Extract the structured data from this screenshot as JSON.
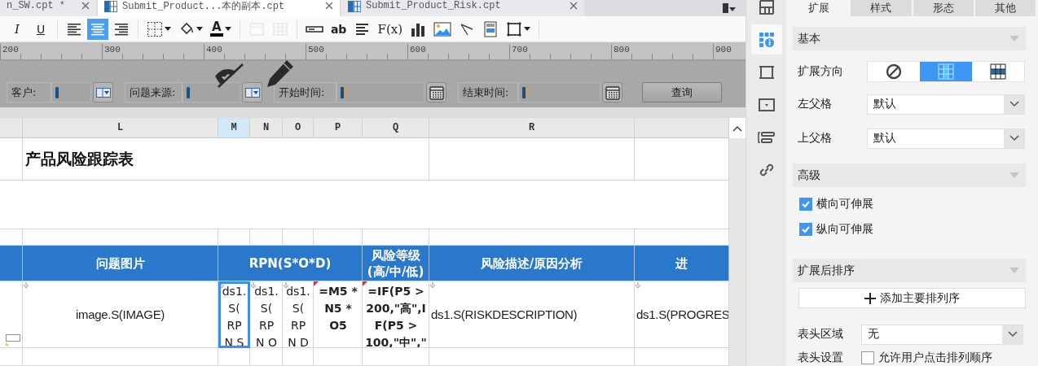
{
  "file_tabs": [
    {
      "label": "n_SW.cpt *",
      "selected": false
    },
    {
      "label": "Submit_Product...本的副本.cpt",
      "selected": true
    },
    {
      "label": "Submit_Product_Risk.cpt",
      "selected": false
    }
  ],
  "toolbar": [
    {
      "kind": "italic",
      "label": "I",
      "selected": false,
      "disabled": false
    },
    {
      "kind": "underline",
      "label": "U",
      "selected": false,
      "disabled": false
    },
    {
      "kind": "sep"
    },
    {
      "kind": "align-left",
      "selected": false,
      "disabled": false
    },
    {
      "kind": "align-center",
      "selected": true,
      "disabled": false
    },
    {
      "kind": "align-right",
      "selected": false,
      "disabled": false
    },
    {
      "kind": "sep"
    },
    {
      "kind": "border",
      "selected": false,
      "disabled": false
    },
    {
      "kind": "fill",
      "selected": false,
      "disabled": false
    },
    {
      "kind": "font-color",
      "label": "A",
      "selected": false,
      "disabled": false
    },
    {
      "kind": "sep"
    },
    {
      "kind": "merge",
      "selected": false,
      "disabled": true
    },
    {
      "kind": "grid",
      "selected": false,
      "disabled": true
    },
    {
      "kind": "sep"
    },
    {
      "kind": "textbox",
      "selected": false,
      "disabled": false
    },
    {
      "kind": "text",
      "label": "ab",
      "selected": false,
      "disabled": false
    },
    {
      "kind": "paragraph",
      "selected": false,
      "disabled": false
    },
    {
      "kind": "formula",
      "label": "F(x)",
      "selected": false,
      "disabled": false
    },
    {
      "kind": "chart",
      "selected": false,
      "disabled": false
    },
    {
      "kind": "image",
      "selected": false,
      "disabled": false
    },
    {
      "kind": "slash",
      "selected": false,
      "disabled": false
    },
    {
      "kind": "subreport",
      "selected": false,
      "disabled": false
    },
    {
      "kind": "frame",
      "selected": false,
      "disabled": false
    },
    {
      "kind": "sep"
    }
  ],
  "ruler": [
    "200",
    "300",
    "400",
    "500",
    "600",
    "700",
    "800",
    "900"
  ],
  "params": [
    {
      "label": "客户:",
      "kind": "dropdown"
    },
    {
      "label": "问题来源:",
      "kind": "dropdown"
    },
    {
      "label": "开始时间:",
      "kind": "date"
    },
    {
      "label": "结束时间:",
      "kind": "date"
    }
  ],
  "query_button": "查询",
  "sheet": {
    "columns": [
      {
        "label": "L",
        "selected": false
      },
      {
        "label": "M",
        "selected": true
      },
      {
        "label": "N",
        "selected": false
      },
      {
        "label": "O",
        "selected": false
      },
      {
        "label": "P",
        "selected": false
      },
      {
        "label": "Q",
        "selected": false
      },
      {
        "label": "R",
        "selected": false
      }
    ],
    "title": "产品风险跟踪表",
    "header_cells": [
      "问题图片",
      "RPN(S*O*D)",
      "风险等级(高/中/低)",
      "风险描述/原因分析",
      "进"
    ],
    "data_cells": [
      {
        "text": "image.S(IMAGE)",
        "kind": "data",
        "selected": false
      },
      {
        "text": "ds1.\nS(\nRP\nN S",
        "kind": "data",
        "selected": true
      },
      {
        "text": "ds1.\nS(\nRP\nN O",
        "kind": "data",
        "selected": false
      },
      {
        "text": "ds1.\nS(\nRP\nN D",
        "kind": "data",
        "selected": false
      },
      {
        "text": "=M5 *\nN5 *\nO5",
        "kind": "formula",
        "selected": false
      },
      {
        "text": "=IF(P5 >\n200,\"高\",I\nF(P5 >\n100,\"中\",\"",
        "kind": "formula",
        "selected": false
      },
      {
        "text": "ds1.S(RISKDESCRIPTION)",
        "kind": "data",
        "selected": false
      },
      {
        "text": "ds1.S(PROGRES",
        "kind": "data",
        "selected": false
      }
    ]
  },
  "side_rail": [
    {
      "kind": "cell-element",
      "selected": false
    },
    {
      "kind": "cell-attr",
      "selected": true
    },
    {
      "kind": "border",
      "selected": false
    },
    {
      "kind": "widget",
      "selected": false
    },
    {
      "kind": "condition",
      "selected": false
    },
    {
      "kind": "link",
      "selected": false
    }
  ],
  "panel": {
    "tabs": [
      {
        "label": "扩展",
        "selected": true
      },
      {
        "label": "样式",
        "selected": false
      },
      {
        "label": "形态",
        "selected": false
      },
      {
        "label": "其他",
        "selected": false
      }
    ],
    "basic": {
      "title": "基本",
      "direction": {
        "label": "扩展方向",
        "options": [
          {
            "kind": "none",
            "selected": false
          },
          {
            "kind": "vertical",
            "selected": true
          },
          {
            "kind": "horizontal",
            "selected": false
          }
        ]
      },
      "selects": [
        {
          "label": "左父格",
          "value": "默认"
        },
        {
          "label": "上父格",
          "value": "默认"
        }
      ]
    },
    "advanced": {
      "title": "高级",
      "checkboxes": [
        {
          "label": "横向可伸展",
          "checked": true
        },
        {
          "label": "纵向可伸展",
          "checked": true
        }
      ]
    },
    "sort": {
      "title": "扩展后排序",
      "add_button": "添加主要排列序",
      "header_area": {
        "label": "表头区域",
        "value": "无"
      },
      "header_setting": {
        "label": "表头设置",
        "checkbox": {
          "label": "允许用户点击排列顺序",
          "checked": false
        }
      }
    }
  }
}
